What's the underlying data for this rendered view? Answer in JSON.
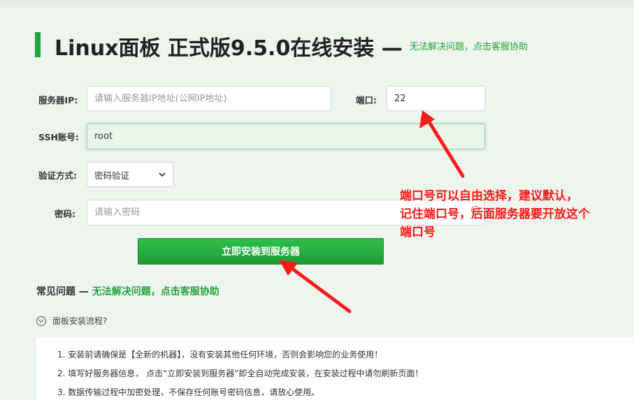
{
  "header": {
    "title": "Linux面板 正式版9.5.0在线安装 —",
    "help_link": "无法解决问题，点击客服协助"
  },
  "form": {
    "server_ip_label": "服务器IP:",
    "server_ip_placeholder": "请输入服务器IP地址(公网IP地址)",
    "port_label": "端口:",
    "port_value": "22",
    "ssh_label": "SSH账号:",
    "ssh_value": "root",
    "auth_label": "验证方式:",
    "auth_selected": "密码验证",
    "password_label": "密码:",
    "password_placeholder": "请输入密码",
    "install_button": "立即安装到服务器"
  },
  "faq": {
    "title": "常见问题 —",
    "help_link": "无法解决问题，点击客服协助",
    "toggle_label": "面板安装流程?",
    "steps": [
      "1. 安装前请确保是【全新的机器】，没有安装其他任何环境，否则会影响您的业务使用！",
      "2. 填写好服务器信息，  点击“立即安装到服务器”即全自动完成安装，在安装过程中请勿刷新页面！",
      "3. 数据传输过程中加密处理，不保存任何账号密码信息，请放心使用。"
    ]
  },
  "annotation": {
    "text": "端口号可以自由选择，建议默认，\n记住端口号，后面服务器要开放这个\n端口号",
    "color": "#ff1a1a"
  },
  "colors": {
    "accent": "#20a53a",
    "background": "#eef5ef"
  }
}
